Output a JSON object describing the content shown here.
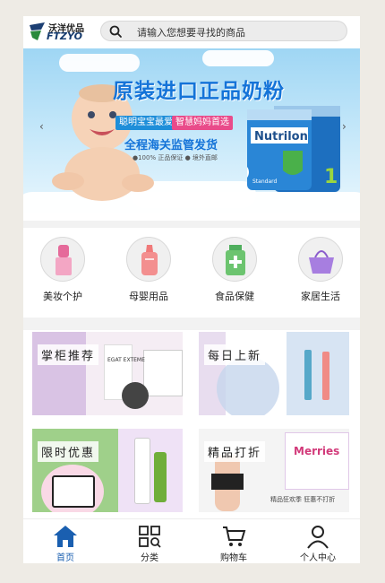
{
  "header": {
    "logo_cn": "沃洋优品",
    "logo_en": "FTZYO",
    "search_placeholder": "请输入您想要寻找的商品"
  },
  "banner": {
    "title": "原装进口正品奶粉",
    "tag1": "聪明宝宝最爱",
    "tag2": "智慧妈妈首选",
    "subtitle": "全程海关监管发货",
    "note": "●100% 正品保证  ● 境外直邮",
    "product_brand": "Nutrilon",
    "product_number": "1",
    "product_variant": "Standard",
    "colors": {
      "title": "#1473d8",
      "tag1": "#1e8ed9",
      "tag2": "#e94b8a"
    }
  },
  "categories": [
    {
      "label": "美妆个护",
      "icon": "lipstick-icon"
    },
    {
      "label": "母婴用品",
      "icon": "baby-bottle-icon"
    },
    {
      "label": "食品保健",
      "icon": "health-jar-icon"
    },
    {
      "label": "家居生活",
      "icon": "basket-icon"
    }
  ],
  "promos": [
    {
      "label": "掌柜推荐",
      "product_text": "EGAT EXTEME"
    },
    {
      "label": "每日上新"
    },
    {
      "label": "限时优惠"
    },
    {
      "label": "精品打折",
      "product_text": "Merries",
      "caption": "精品狂欢季 狂惠不打折"
    }
  ],
  "nav": [
    {
      "label": "首页",
      "icon": "home-icon",
      "active": true
    },
    {
      "label": "分类",
      "icon": "category-grid-icon",
      "active": false
    },
    {
      "label": "购物车",
      "icon": "cart-icon",
      "active": false
    },
    {
      "label": "个人中心",
      "icon": "user-icon",
      "active": false
    }
  ],
  "accent_color": "#1a5fb0"
}
